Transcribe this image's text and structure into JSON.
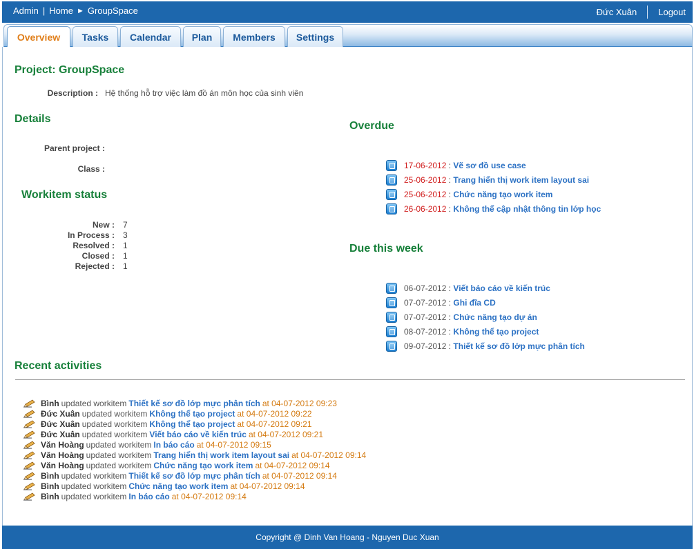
{
  "colors": {
    "header_bg": "#1d67ad",
    "heading": "#17803a",
    "link": "#2d72c4",
    "overdue_date": "#d11f1f",
    "timestamp": "#d47a10",
    "active_tab": "#e07f1b"
  },
  "breadcrumb": {
    "admin": "Admin",
    "separator": "|",
    "home": "Home",
    "arrow": "►",
    "current": "GroupSpace"
  },
  "user": {
    "name": "Đức Xuân",
    "logout": "Logout"
  },
  "tabs": [
    {
      "label": "Overview",
      "active": true
    },
    {
      "label": "Tasks"
    },
    {
      "label": "Calendar"
    },
    {
      "label": "Plan"
    },
    {
      "label": "Members"
    },
    {
      "label": "Settings"
    }
  ],
  "project": {
    "title": "Project: GroupSpace",
    "description_label": "Description :",
    "description": "Hệ thống hỗ trợ việc làm đồ án môn học của sinh viên"
  },
  "details": {
    "heading": "Details",
    "parent_label": "Parent project :",
    "parent_value": "",
    "class_label": "Class :",
    "class_value": ""
  },
  "workitem_status": {
    "heading": "Workitem status",
    "rows": [
      {
        "label": "New :",
        "value": "7"
      },
      {
        "label": "In Process :",
        "value": "3"
      },
      {
        "label": "Resolved :",
        "value": "1"
      },
      {
        "label": "Closed :",
        "value": "1"
      },
      {
        "label": "Rejected :",
        "value": "1"
      }
    ]
  },
  "overdue": {
    "heading": "Overdue",
    "items": [
      {
        "date": "17-06-2012",
        "sep": " : ",
        "title": "Vẽ sơ đồ use case"
      },
      {
        "date": "25-06-2012",
        "sep": " : ",
        "title": "Trang hiển thị work item layout sai"
      },
      {
        "date": "25-06-2012",
        "sep": " : ",
        "title": "Chức năng tạo work item"
      },
      {
        "date": "26-06-2012",
        "sep": " : ",
        "title": "Không thể cập nhật thông tin lớp học"
      }
    ]
  },
  "due_this_week": {
    "heading": "Due this week",
    "items": [
      {
        "date": "06-07-2012",
        "sep": " : ",
        "title": "Viết báo cáo về kiến trúc"
      },
      {
        "date": "07-07-2012",
        "sep": " : ",
        "title": "Ghi đĩa CD"
      },
      {
        "date": "07-07-2012",
        "sep": " : ",
        "title": "Chức năng tạo dự án"
      },
      {
        "date": "08-07-2012",
        "sep": " : ",
        "title": "Không thể tạo project"
      },
      {
        "date": "09-07-2012",
        "sep": " : ",
        "title": "Thiết kế sơ đồ lớp mực phân tích"
      }
    ]
  },
  "recent": {
    "heading": "Recent activities",
    "items": [
      {
        "user": "Bình",
        "verb": "updated workitem",
        "item": "Thiết kế sơ đồ lớp mực phân tích",
        "time": "at 04-07-2012 09:23"
      },
      {
        "user": "Đức Xuân",
        "verb": "updated workitem",
        "item": "Không thể tạo project",
        "time": "at 04-07-2012 09:22"
      },
      {
        "user": "Đức Xuân",
        "verb": "updated workitem",
        "item": "Không thể tạo project",
        "time": "at 04-07-2012 09:21"
      },
      {
        "user": "Đức Xuân",
        "verb": "updated workitem",
        "item": "Viết báo cáo về kiến trúc",
        "time": "at 04-07-2012 09:21"
      },
      {
        "user": "Văn Hoàng",
        "verb": "updated workitem",
        "item": "In báo cáo",
        "time": "at 04-07-2012 09:15"
      },
      {
        "user": "Văn Hoàng",
        "verb": "updated workitem",
        "item": "Trang hiển thị work item layout sai",
        "time": "at 04-07-2012 09:14"
      },
      {
        "user": "Văn Hoàng",
        "verb": "updated workitem",
        "item": "Chức năng tạo work item",
        "time": "at 04-07-2012 09:14"
      },
      {
        "user": "Bình",
        "verb": "updated workitem",
        "item": "Thiết kế sơ đồ lớp mực phân tích",
        "time": "at 04-07-2012 09:14"
      },
      {
        "user": "Bình",
        "verb": "updated workitem",
        "item": "Chức năng tạo work item",
        "time": "at 04-07-2012 09:14"
      },
      {
        "user": "Bình",
        "verb": "updated workitem",
        "item": "In báo cáo",
        "time": "at 04-07-2012 09:14"
      }
    ]
  },
  "footer": {
    "copyright": "Copyright @ Dinh Van Hoang - Nguyen Duc Xuan"
  }
}
